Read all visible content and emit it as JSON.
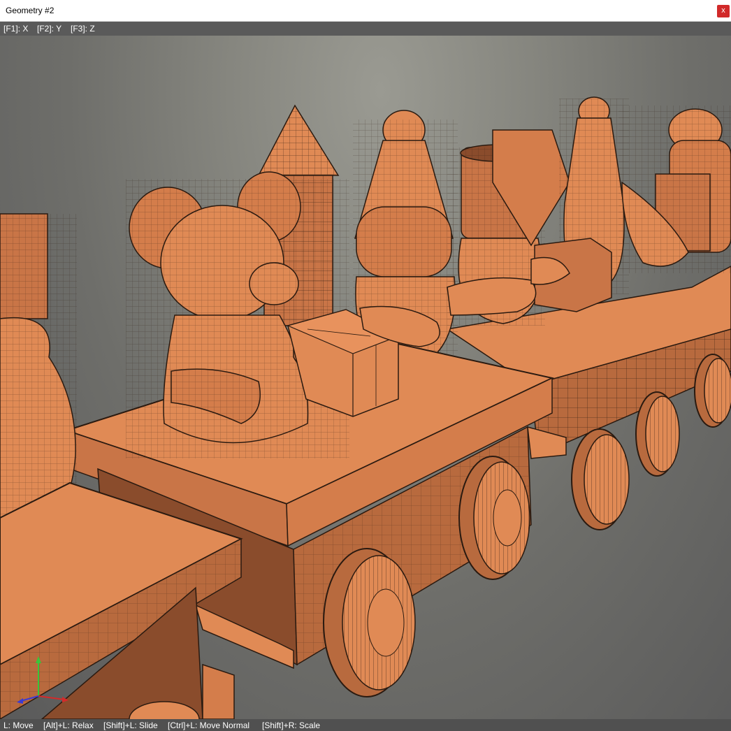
{
  "window": {
    "title": "Geometry #2",
    "close_label": "x"
  },
  "axis_toggles": [
    {
      "label": "[F1]: X"
    },
    {
      "label": "[F2]: Y"
    },
    {
      "label": "[F3]: Z"
    }
  ],
  "status_hints": [
    {
      "label": "L: Move"
    },
    {
      "label": "[Alt]+L: Relax"
    },
    {
      "label": "[Shift]+L: Slide"
    },
    {
      "label": "[Ctrl]+L: Move Normal"
    },
    {
      "label": "[Shift]+R: Scale"
    }
  ],
  "viewport": {
    "object_color": "#e08a55",
    "object_shadow_color": "#b86a3e",
    "wire_color": "#2a1a10",
    "axes": [
      "x-axis",
      "y-axis",
      "z-axis"
    ],
    "axis_colors": {
      "x": "#d42a2a",
      "y": "#3ac43a",
      "z": "#3a3ad4"
    }
  }
}
